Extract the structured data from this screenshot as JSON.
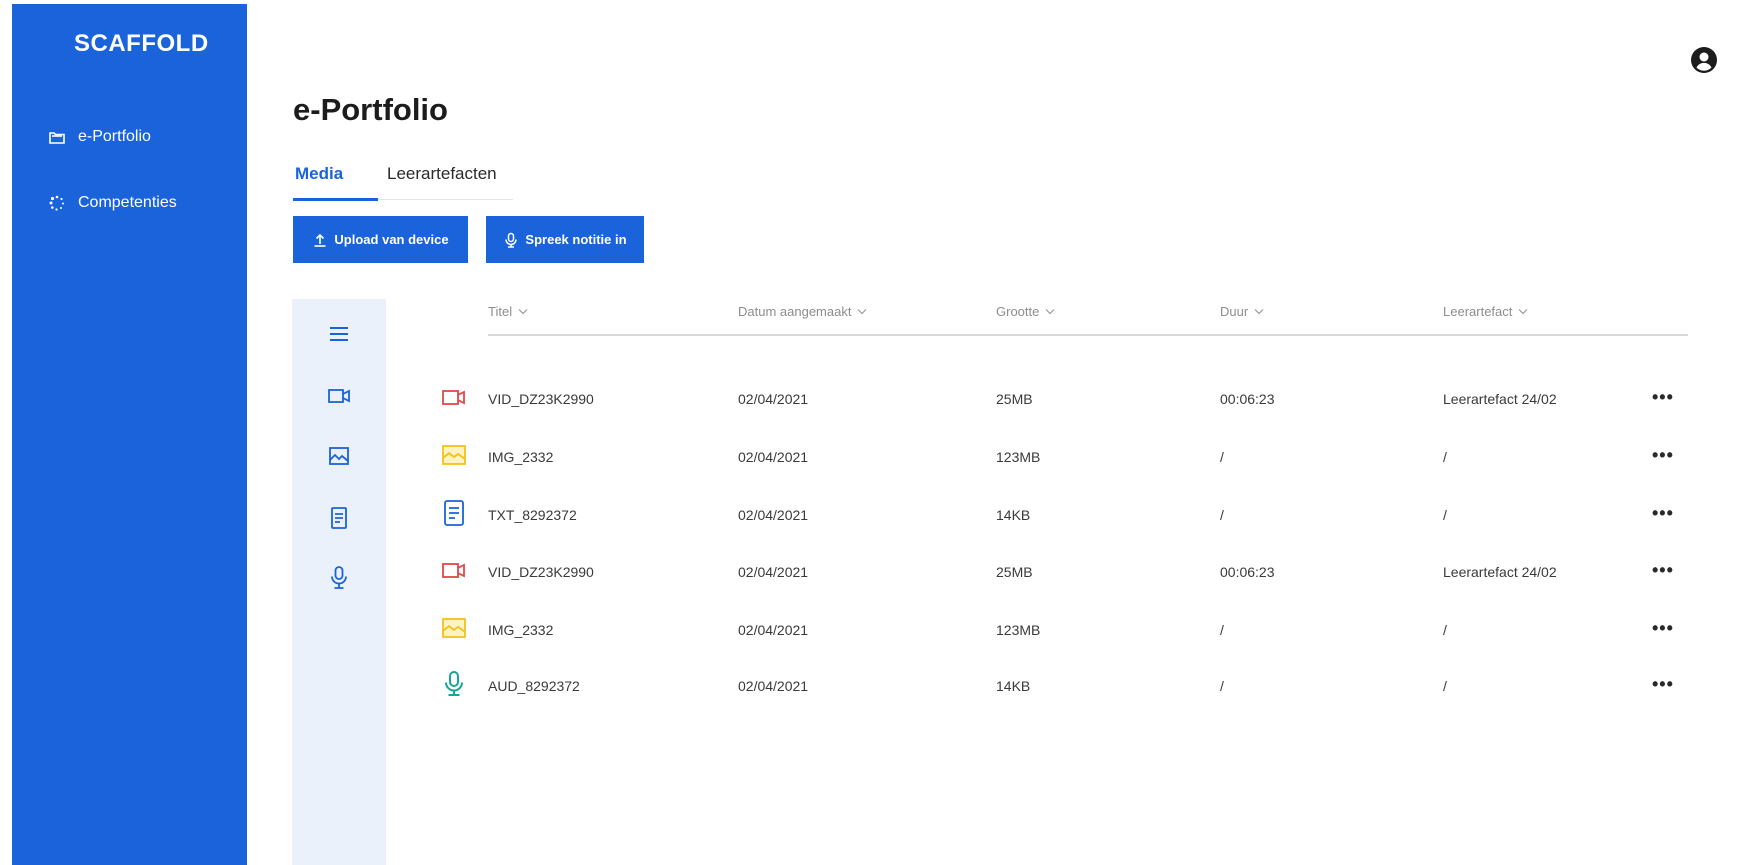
{
  "app": {
    "brand": "SCAFFOLD"
  },
  "sidebar": {
    "items": [
      {
        "label": "e-Portfolio",
        "icon": "folder-icon"
      },
      {
        "label": "Competenties",
        "icon": "spinner-icon"
      }
    ]
  },
  "header": {
    "title": "e-Portfolio",
    "user_icon": "user-circle-icon"
  },
  "tabs": [
    {
      "label": "Media",
      "active": true
    },
    {
      "label": "Leerartefacten",
      "active": false
    }
  ],
  "toolbar": {
    "upload_label": "Upload van device",
    "speak_label": "Spreek notitie in"
  },
  "filters": [
    "all-list-icon",
    "video-icon",
    "image-icon",
    "document-icon",
    "microphone-icon"
  ],
  "table": {
    "columns": [
      "Titel",
      "Datum aangemaakt",
      "Grootte",
      "Duur",
      "Leerartefact"
    ],
    "rows": [
      {
        "type": "video",
        "title": "VID_DZ23K2990",
        "date": "02/04/2021",
        "size": "25MB",
        "duration": "00:06:23",
        "artefact": "Leerartefact 24/02"
      },
      {
        "type": "image",
        "title": "IMG_2332",
        "date": "02/04/2021",
        "size": "123MB",
        "duration": "/",
        "artefact": "/"
      },
      {
        "type": "text",
        "title": "TXT_8292372",
        "date": "02/04/2021",
        "size": "14KB",
        "duration": "/",
        "artefact": "/"
      },
      {
        "type": "video",
        "title": "VID_DZ23K2990",
        "date": "02/04/2021",
        "size": "25MB",
        "duration": "00:06:23",
        "artefact": "Leerartefact 24/02"
      },
      {
        "type": "image",
        "title": "IMG_2332",
        "date": "02/04/2021",
        "size": "123MB",
        "duration": "/",
        "artefact": "/"
      },
      {
        "type": "audio",
        "title": "AUD_8292372",
        "date": "02/04/2021",
        "size": "14KB",
        "duration": "/",
        "artefact": "/"
      }
    ],
    "more_label": "•••"
  },
  "colors": {
    "primary": "#1a63db",
    "rail_bg": "#eaf1fb",
    "video": "#e04848",
    "image": "#f2c21b",
    "text": "#1a63db",
    "audio": "#1aa39a"
  }
}
